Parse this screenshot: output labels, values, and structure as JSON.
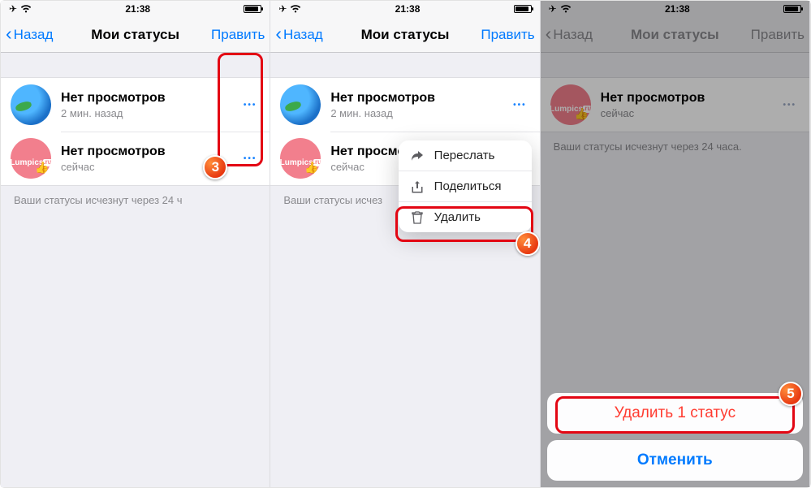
{
  "statusbar": {
    "time": "21:38"
  },
  "nav": {
    "back": "Назад",
    "title": "Мои статусы",
    "edit": "Править"
  },
  "rows": {
    "globe": {
      "title": "Нет просмотров",
      "sub": "2 мин. назад"
    },
    "lumpics": {
      "title": "Нет просмотров",
      "sub": "сейчас",
      "brand": "Lumpics",
      "brand_ru": ".ru"
    }
  },
  "note": "Ваши статусы исчезнут через 24 часа.",
  "note_cut": "Ваши статусы исчезнут через 24 ч",
  "note_cut2": "Ваши статусы исчез",
  "ctx": {
    "forward": "Переслать",
    "share": "Поделиться",
    "delete": "Удалить"
  },
  "sheet": {
    "delete1": "Удалить 1 статус",
    "cancel": "Отменить"
  },
  "badges": {
    "b3": "3",
    "b4": "4",
    "b5": "5"
  }
}
